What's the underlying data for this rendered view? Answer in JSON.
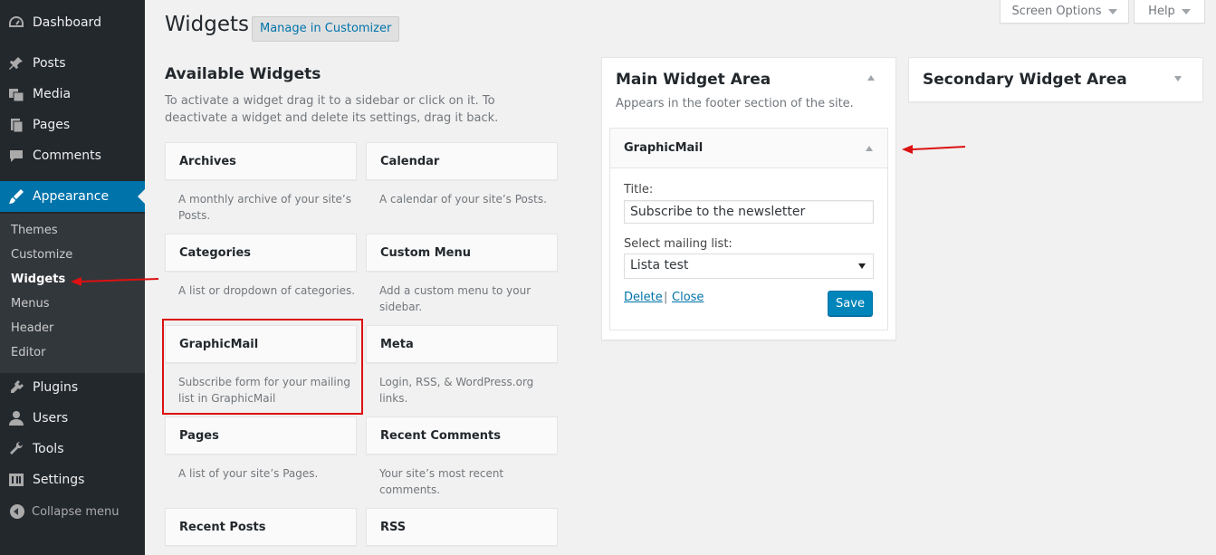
{
  "sidebar": {
    "menu": [
      {
        "label": "Dashboard",
        "icon": "dashboard-icon"
      },
      {
        "label": "Posts",
        "icon": "pin-icon"
      },
      {
        "label": "Media",
        "icon": "media-icon"
      },
      {
        "label": "Pages",
        "icon": "pages-icon"
      },
      {
        "label": "Comments",
        "icon": "comment-icon"
      },
      {
        "label": "Appearance",
        "icon": "brush-icon"
      },
      {
        "label": "Plugins",
        "icon": "plugin-icon"
      },
      {
        "label": "Users",
        "icon": "user-icon"
      },
      {
        "label": "Tools",
        "icon": "wrench-icon"
      },
      {
        "label": "Settings",
        "icon": "settings-icon"
      }
    ],
    "submenu": [
      "Themes",
      "Customize",
      "Widgets",
      "Menus",
      "Header",
      "Editor"
    ],
    "collapse_label": "Collapse menu"
  },
  "top": {
    "screen_options": "Screen Options",
    "help": "Help"
  },
  "page": {
    "title": "Widgets",
    "action": "Manage in Customizer"
  },
  "available": {
    "title": "Available Widgets",
    "description": "To activate a widget drag it to a sidebar or click on it. To deactivate a widget and delete its settings, drag it back.",
    "widgets": [
      {
        "name": "Archives",
        "desc": "A monthly archive of your site’s Posts."
      },
      {
        "name": "Calendar",
        "desc": "A calendar of your site’s Posts."
      },
      {
        "name": "Categories",
        "desc": "A list or dropdown of categories."
      },
      {
        "name": "Custom Menu",
        "desc": "Add a custom menu to your sidebar."
      },
      {
        "name": "GraphicMail",
        "desc": "Subscribe form for your mailing list in GraphicMail"
      },
      {
        "name": "Meta",
        "desc": "Login, RSS, & WordPress.org links."
      },
      {
        "name": "Pages",
        "desc": "A list of your site’s Pages."
      },
      {
        "name": "Recent Comments",
        "desc": "Your site’s most recent comments."
      },
      {
        "name": "Recent Posts",
        "desc": ""
      },
      {
        "name": "RSS",
        "desc": ""
      }
    ]
  },
  "main_area": {
    "title": "Main Widget Area",
    "description": "Appears in the footer section of the site.",
    "widget": {
      "title": "GraphicMail",
      "title_label": "Title:",
      "title_value": "Subscribe to the newsletter",
      "list_label": "Select mailing list:",
      "list_value": "Lista test",
      "delete_label": "Delete",
      "separator": "|",
      "close_label": "Close",
      "save_label": "Save"
    }
  },
  "secondary_area": {
    "title": "Secondary Widget Area"
  },
  "colors": {
    "sidebar_bg": "#23282d",
    "active": "#0073aa",
    "annotation": "#dd1111",
    "primary_button": "#0085ba"
  }
}
